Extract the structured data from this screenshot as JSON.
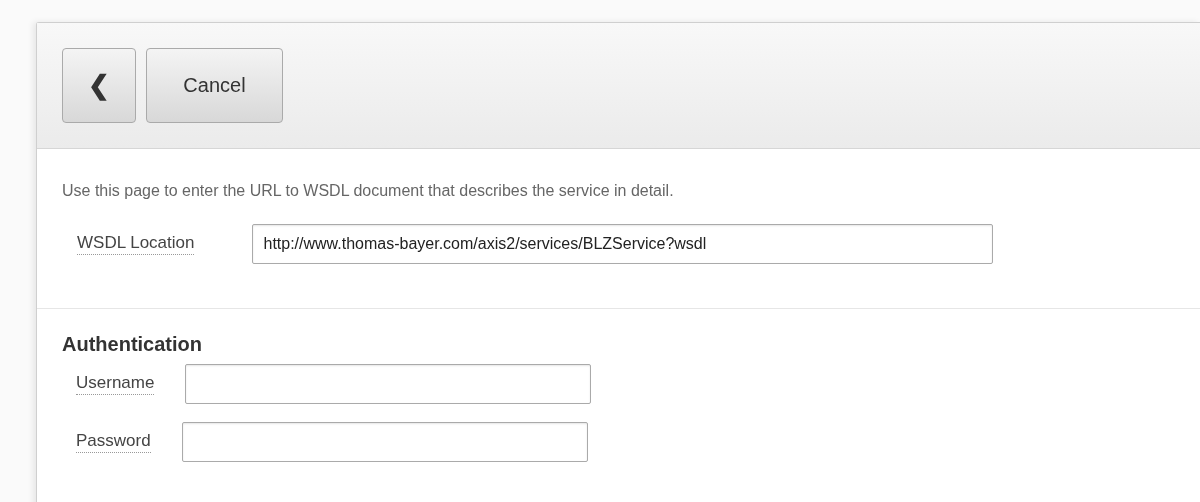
{
  "toolbar": {
    "back_button": "❮",
    "cancel_button": "Cancel"
  },
  "description": "Use this page to enter the URL to WSDL document that describes the service in detail.",
  "wsdl": {
    "label": "WSDL Location",
    "value": "http://www.thomas-bayer.com/axis2/services/BLZService?wsdl"
  },
  "authentication": {
    "heading": "Authentication",
    "fields": [
      {
        "label": "Username"
      },
      {
        "label": "Password"
      }
    ]
  }
}
